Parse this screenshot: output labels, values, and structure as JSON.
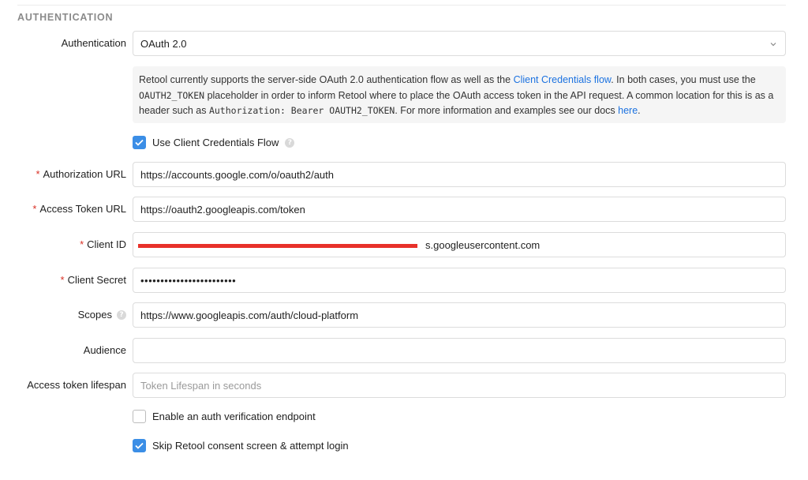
{
  "section": {
    "heading": "AUTHENTICATION"
  },
  "authentication": {
    "label": "Authentication",
    "selected_value": "OAuth 2.0",
    "chevron_icon": "chevron-down-icon"
  },
  "info": {
    "text_1": "Retool currently supports the server-side OAuth 2.0 authentication flow as well as the ",
    "link_1": "Client Credentials flow",
    "text_2": ". In both cases, you must use the ",
    "code_1": "OAUTH2_TOKEN",
    "text_3": " placeholder in order to inform Retool where to place the OAuth access token in the API request. A common location for this is as a header such as ",
    "code_2": "Authorization: Bearer OAUTH2_TOKEN",
    "text_4": ". For more information and examples see our docs ",
    "link_2": "here",
    "text_5": "."
  },
  "client_credentials": {
    "label": "Use Client Credentials Flow",
    "checked": true
  },
  "fields": {
    "authorization_url": {
      "label": "Authorization URL",
      "required": "*",
      "value": "https://accounts.google.com/o/oauth2/auth"
    },
    "access_token_url": {
      "label": "Access Token URL",
      "required": "*",
      "value": "https://oauth2.googleapis.com/token"
    },
    "client_id": {
      "label": "Client ID",
      "required": "*",
      "value_suffix": "s.googleusercontent.com"
    },
    "client_secret": {
      "label": "Client Secret",
      "required": "*",
      "value": "••••••••••••••••••••••••"
    },
    "scopes": {
      "label": "Scopes",
      "value": "https://www.googleapis.com/auth/cloud-platform"
    },
    "audience": {
      "label": "Audience",
      "value": ""
    },
    "access_token_lifespan": {
      "label": "Access token lifespan",
      "placeholder": "Token Lifespan in seconds"
    }
  },
  "options": {
    "auth_verification": {
      "label": "Enable an auth verification endpoint",
      "checked": false
    },
    "skip_consent": {
      "label": "Skip Retool consent screen & attempt login",
      "checked": true
    }
  },
  "colors": {
    "accent": "#3b8ee6",
    "link": "#1c72e0",
    "required": "#d93025",
    "redaction": "#e8312a"
  }
}
